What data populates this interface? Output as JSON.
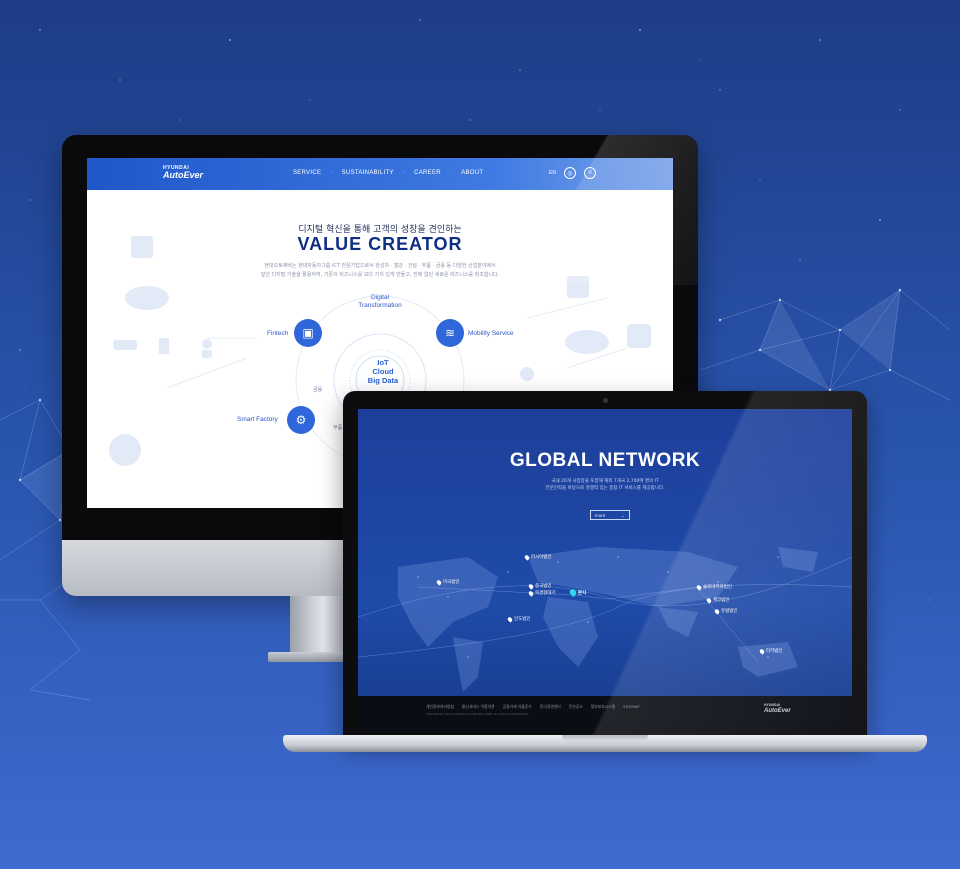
{
  "desktop_site": {
    "logo_top": "HYUNDAI",
    "logo_main": "AutoEver",
    "nav": [
      "SERVICE",
      "SUSTAINABILITY",
      "CAREER",
      "ABOUT"
    ],
    "lang": "EN",
    "hero_subtitle": "디지털 혁신을 통해 고객의 성장을 견인하는",
    "hero_title": "VALUE CREATOR",
    "hero_desc_1": "현대오토에버는 현대자동차그룹 ICT 전문기업으로서 완성차 · 철강 · 건설 · 부품 · 금융 등 다양한 산업분야에서",
    "hero_desc_2": "앞선 디지털 기술을 활용하여, 기존의 비즈니스를 보다 가치 있게 만들고, 전에 없던 새로운 비즈니스를 창조합니다.",
    "nodes": {
      "digital": "Digital Transformation",
      "fintech": "Fintech",
      "mobility": "Mobility Service",
      "factory": "Smart Factory"
    },
    "hub": [
      "IoT",
      "Cloud",
      "Big Data"
    ],
    "ring_labels": [
      "금융",
      "부품"
    ]
  },
  "laptop_site": {
    "title": "GLOBAL NETWORK",
    "desc_1": "국내 20개 사업장을 포함해 해외 7개국 2,700여 명의 IT",
    "desc_2": "전문인력을 바탕으로 경쟁력 있는 종합 IT 서비스를 제공합니다.",
    "more": "more",
    "pins": {
      "russia": "러시아법인",
      "usa": "미국법인",
      "china": "중국법인",
      "beijing": "북경현대기",
      "hq": "본사",
      "india": "인도법인",
      "europe": "유럽법인",
      "czech": "체코법인",
      "slovakia": "슬로바키아법인",
      "turkey": "터키법인"
    },
    "footer_links": [
      "개인정보처리방침",
      "통신서비스 이용약관",
      "공정거래 자율준수",
      "윤리경영센터",
      "전자공고",
      "정보보호시스템",
      "SITEMAP"
    ],
    "footer_copy": "COPYRIGHT 2019 HYUNDAI AUTOEVER CORP. ALL RIGHTS RESERVED.",
    "logo_top": "HYUNDAI",
    "logo_main": "AutoEver"
  }
}
